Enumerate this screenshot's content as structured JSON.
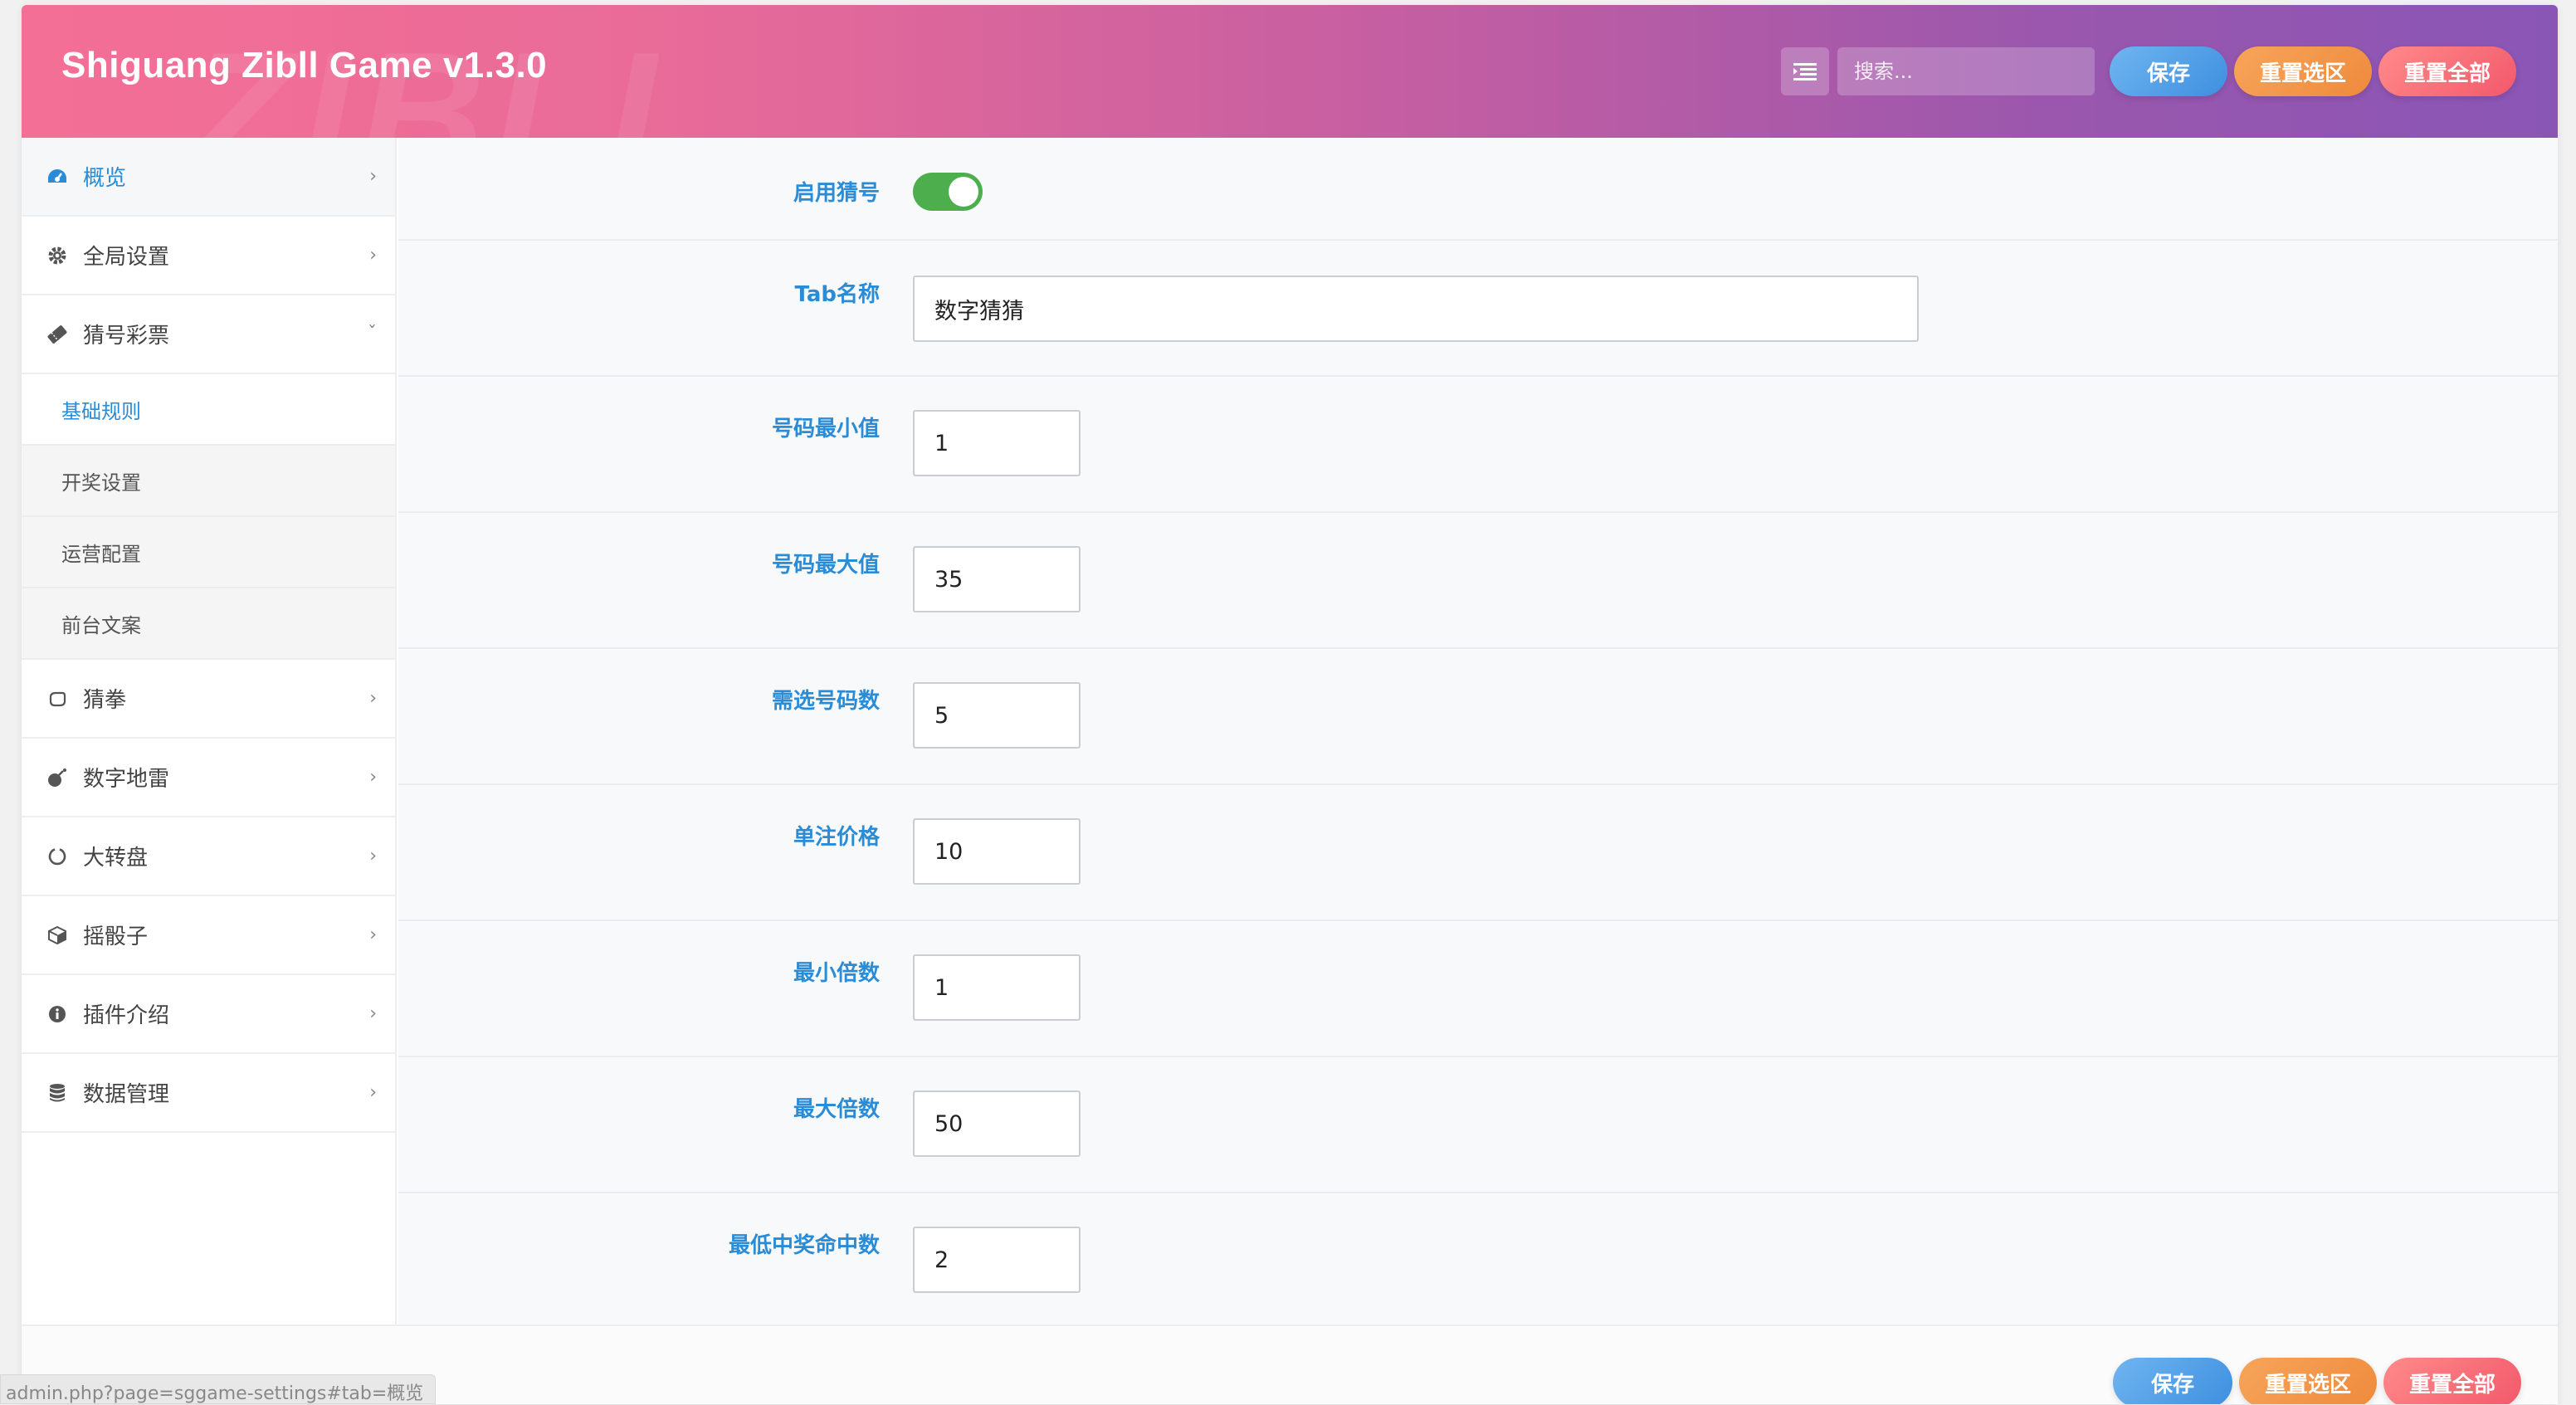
{
  "header": {
    "title": "Shiguang Zibll Game v1.3.0",
    "watermark": "ZIBLL",
    "search_placeholder": "搜索...",
    "save_label": "保存",
    "reset_section_label": "重置选区",
    "reset_all_label": "重置全部"
  },
  "sidebar": {
    "items": [
      {
        "label": "概览",
        "icon": "dashboard-icon",
        "active": true
      },
      {
        "label": "全局设置",
        "icon": "gear-icon"
      },
      {
        "label": "猜号彩票",
        "icon": "ticket-icon",
        "expanded": true
      },
      {
        "label": "猜拳",
        "icon": "hand-icon"
      },
      {
        "label": "数字地雷",
        "icon": "bomb-icon"
      },
      {
        "label": "大转盘",
        "icon": "circle-notch-icon"
      },
      {
        "label": "摇骰子",
        "icon": "cube-icon"
      },
      {
        "label": "插件介绍",
        "icon": "info-icon"
      },
      {
        "label": "数据管理",
        "icon": "database-icon"
      }
    ],
    "submenu": [
      {
        "label": "基础规则",
        "active": true
      },
      {
        "label": "开奖设置"
      },
      {
        "label": "运营配置"
      },
      {
        "label": "前台文案"
      }
    ]
  },
  "form": {
    "enable_label": "启用猜号",
    "enable_on": true,
    "fields": [
      {
        "label": "Tab名称",
        "value": "数字猜猜"
      },
      {
        "label": "号码最小值",
        "value": "1"
      },
      {
        "label": "号码最大值",
        "value": "35"
      },
      {
        "label": "需选号码数",
        "value": "5"
      },
      {
        "label": "单注价格",
        "value": "10"
      },
      {
        "label": "最小倍数",
        "value": "1"
      },
      {
        "label": "最大倍数",
        "value": "50"
      },
      {
        "label": "最低中奖命中数",
        "value": "2"
      }
    ]
  },
  "footer": {
    "save_label": "保存",
    "reset_section_label": "重置选区",
    "reset_all_label": "重置全部"
  },
  "status_url": "admin.php?page=sggame-settings#tab=概览",
  "colors": {
    "accent": "#2a8bd6",
    "toggle_on": "#4cae4c",
    "header_start": "#f46f96",
    "header_end": "#8a56b6"
  }
}
